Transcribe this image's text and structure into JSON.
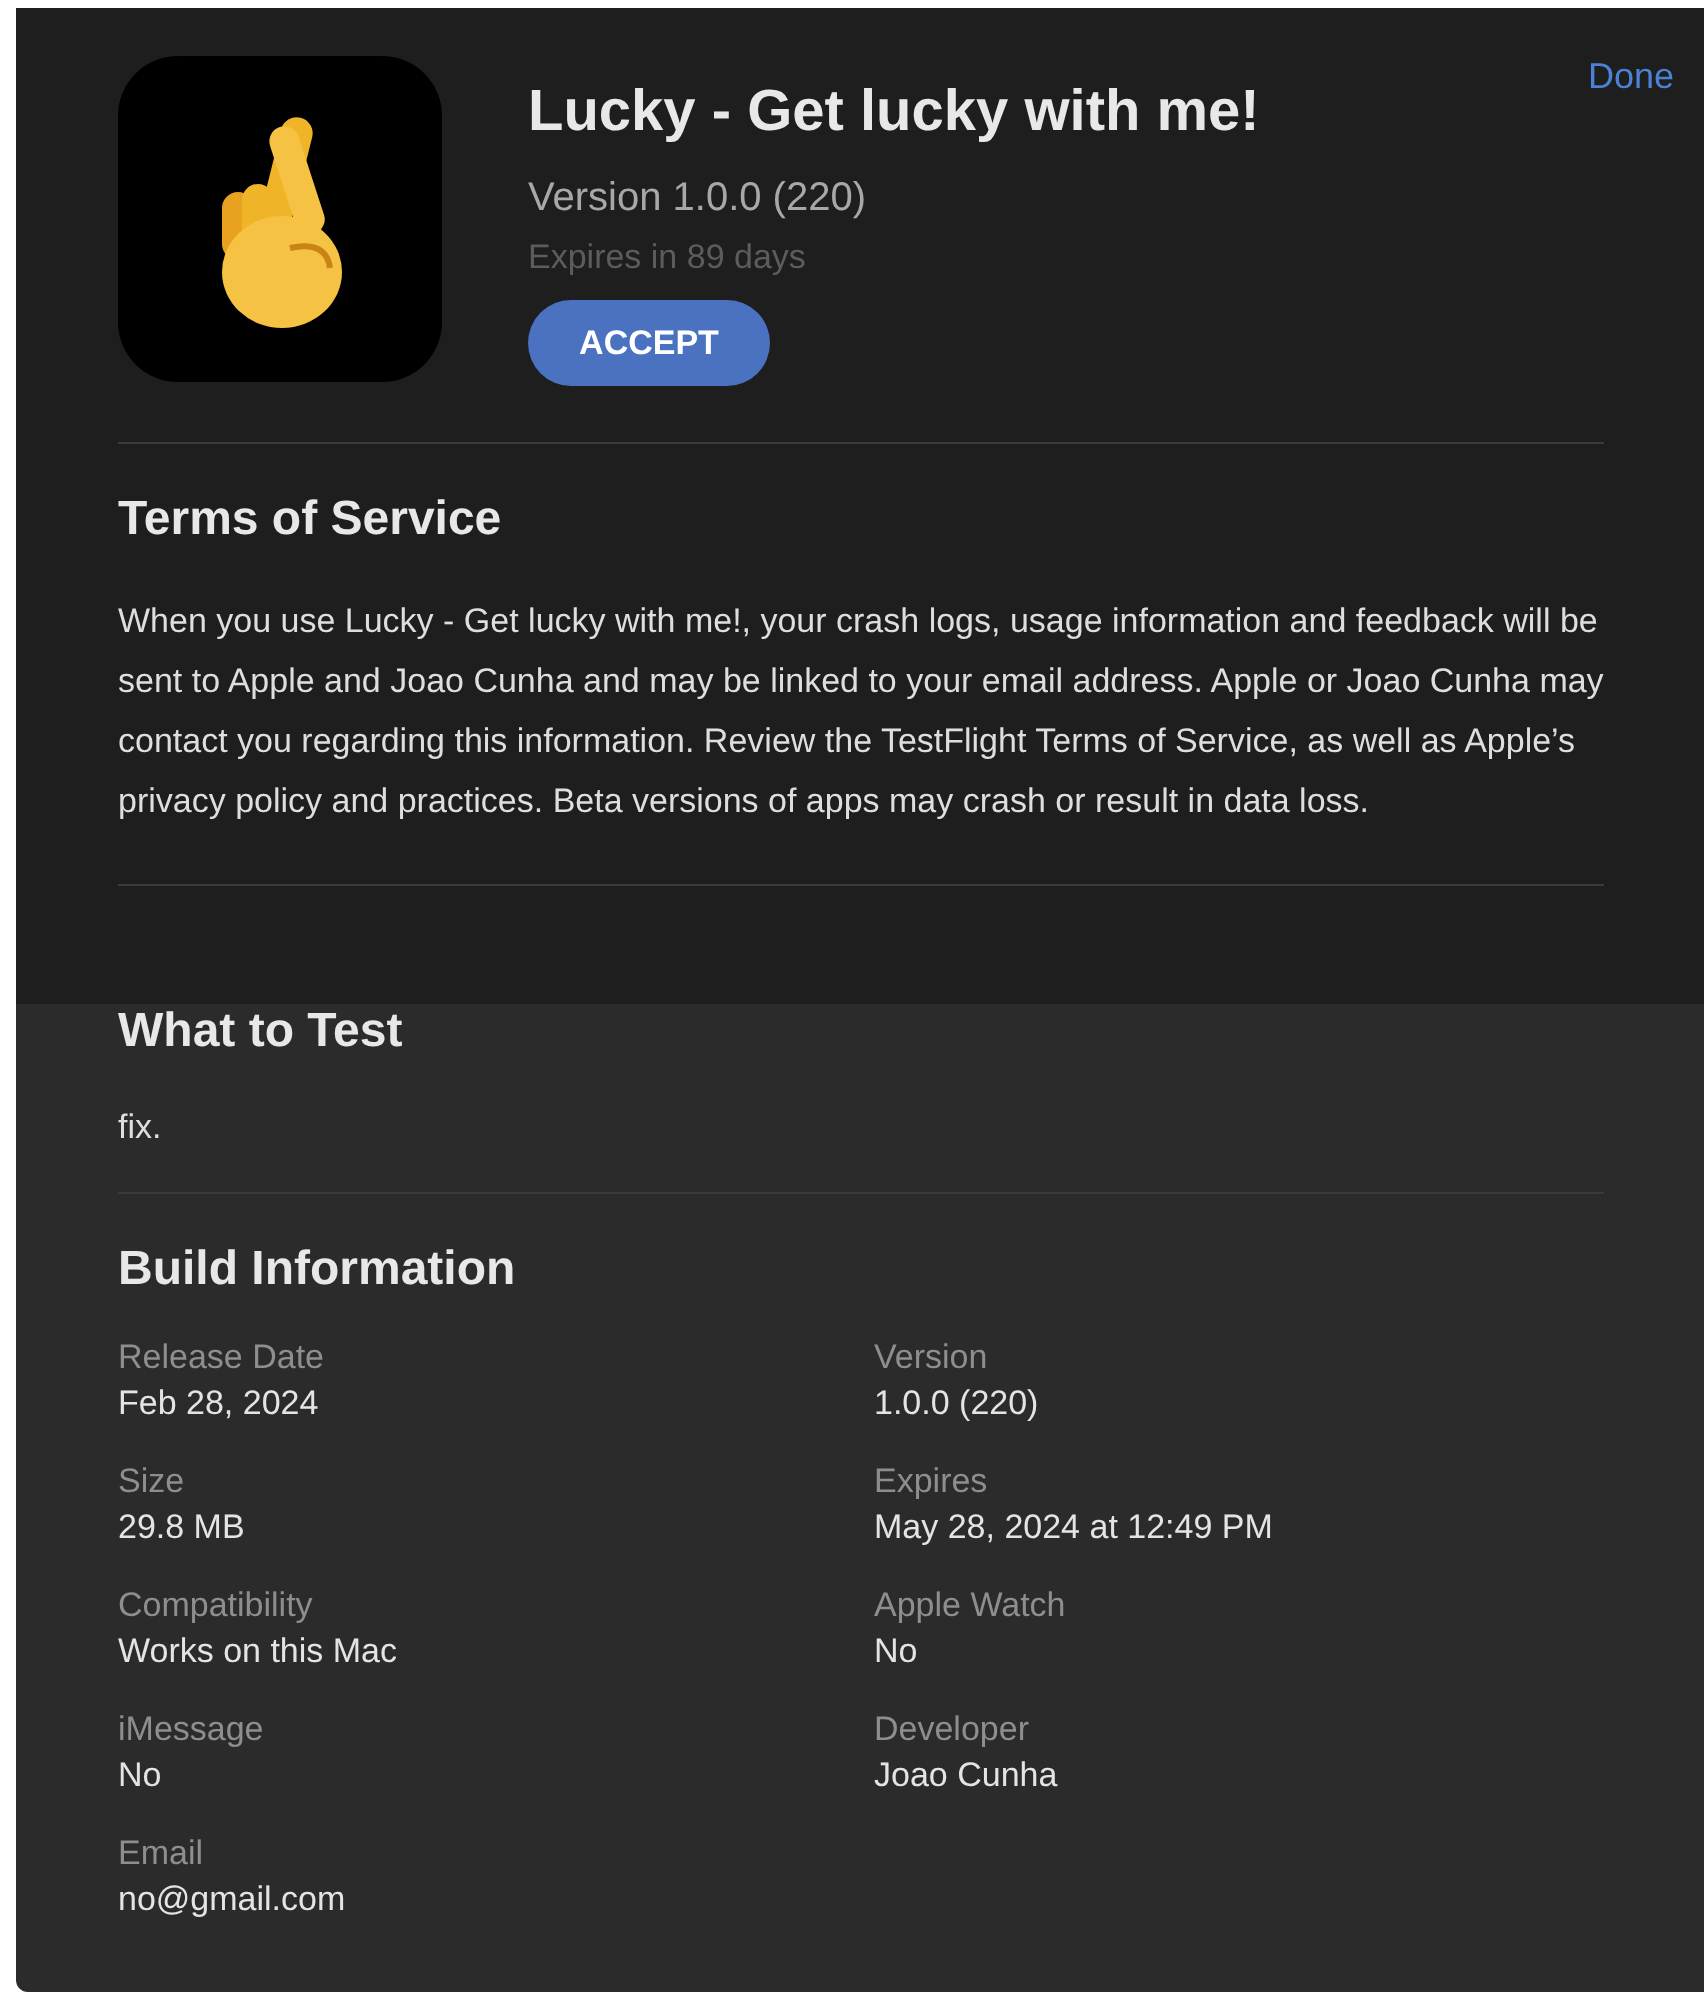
{
  "header": {
    "done": "Done",
    "title": "Lucky - Get lucky with me!",
    "version": "Version 1.0.0 (220)",
    "expires": "Expires in 89 days",
    "accept": "ACCEPT"
  },
  "terms": {
    "heading": "Terms of Service",
    "text": "When you use Lucky - Get lucky with me!, your crash logs, usage information and feedback will be sent to Apple and Joao Cunha and may be linked to your email address. Apple or Joao Cunha may contact you regarding this information. Review the TestFlight Terms of Service, as well as Apple’s privacy policy and practices. Beta versions of apps may crash or result in data loss."
  },
  "what_to_test": {
    "heading": "What to Test",
    "text": "fix."
  },
  "build_information": {
    "heading": "Build Information",
    "fields": [
      {
        "label": "Release Date",
        "value": "Feb 28, 2024"
      },
      {
        "label": "Version",
        "value": "1.0.0 (220)"
      },
      {
        "label": "Size",
        "value": "29.8 MB"
      },
      {
        "label": "Expires",
        "value": "May 28, 2024 at 12:49 PM"
      },
      {
        "label": "Compatibility",
        "value": "Works on this Mac"
      },
      {
        "label": "Apple Watch",
        "value": "No"
      },
      {
        "label": "iMessage",
        "value": "No"
      },
      {
        "label": "Developer",
        "value": "Joao Cunha"
      },
      {
        "label": "Email",
        "value": "no@gmail.com"
      }
    ]
  }
}
